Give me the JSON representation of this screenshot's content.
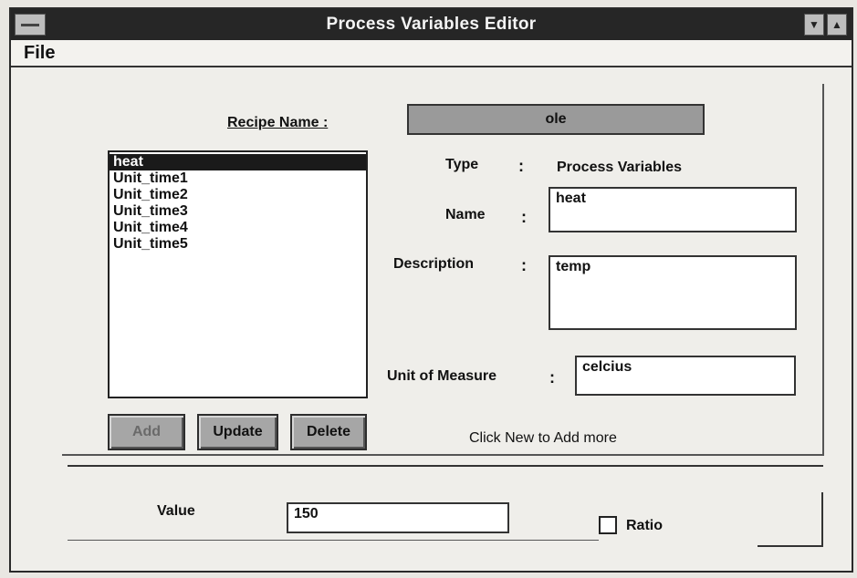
{
  "window": {
    "title": "Process Variables Editor"
  },
  "menubar": {
    "file_label": "File"
  },
  "recipe": {
    "label": "Recipe Name :",
    "value": "ole"
  },
  "variables_list": [
    "heat",
    "Unit_time1",
    "Unit_time2",
    "Unit_time3",
    "Unit_time4",
    "Unit_time5"
  ],
  "form": {
    "type_label": "Type",
    "type_value": "Process Variables",
    "name_label": "Name",
    "name_value": "heat",
    "description_label": "Description",
    "description_value": "temp",
    "unit_label": "Unit of Measure",
    "unit_value": "celcius",
    "colon": ":"
  },
  "buttons": {
    "add": "Add",
    "update": "Update",
    "delete": "Delete"
  },
  "hint": "Click New to Add more",
  "value_row": {
    "label": "Value",
    "value": "150",
    "ratio_label": "Ratio"
  }
}
